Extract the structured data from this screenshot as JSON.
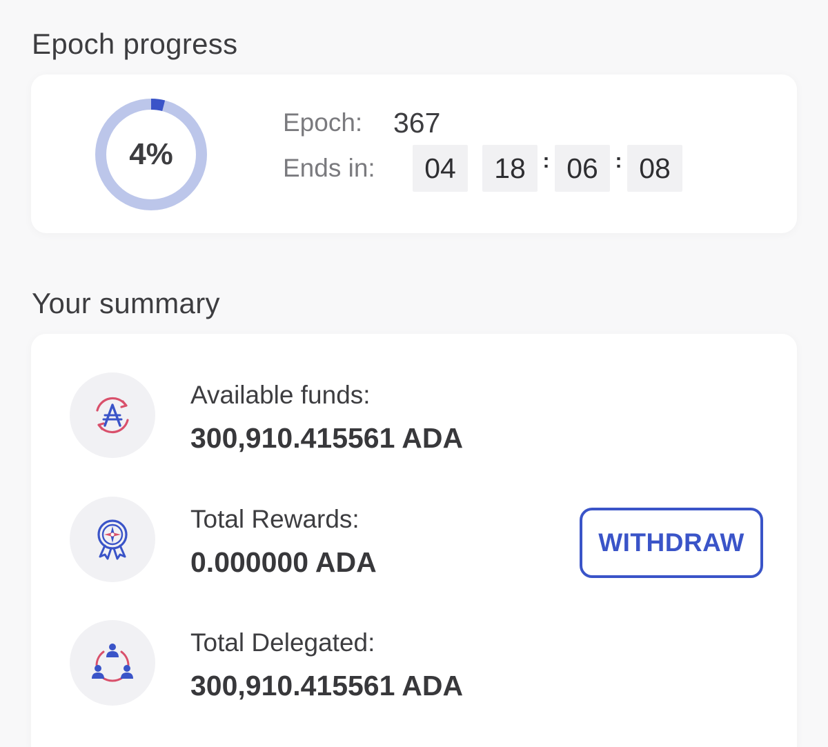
{
  "epoch_progress": {
    "title": "Epoch progress",
    "percent_label": "4%",
    "progress_fraction": 0.04,
    "epoch_label": "Epoch:",
    "epoch_value": "367",
    "ends_in_label": "Ends in:",
    "countdown": {
      "days": "04",
      "hours": "18",
      "minutes": "06",
      "seconds": "08",
      "separator": ":"
    }
  },
  "summary": {
    "title": "Your summary",
    "items": [
      {
        "label": "Available funds:",
        "value": "300,910.415561 ADA",
        "icon": "ada-exchange-icon"
      },
      {
        "label": "Total Rewards:",
        "value": "0.000000 ADA",
        "icon": "reward-badge-icon"
      },
      {
        "label": "Total Delegated:",
        "value": "300,910.415561 ADA",
        "icon": "delegation-users-icon"
      }
    ],
    "withdraw_label": "WITHDRAW"
  },
  "colors": {
    "accent_blue": "#3a54c8",
    "ring_track": "#bcc6ea",
    "accent_red": "#d9506b"
  }
}
